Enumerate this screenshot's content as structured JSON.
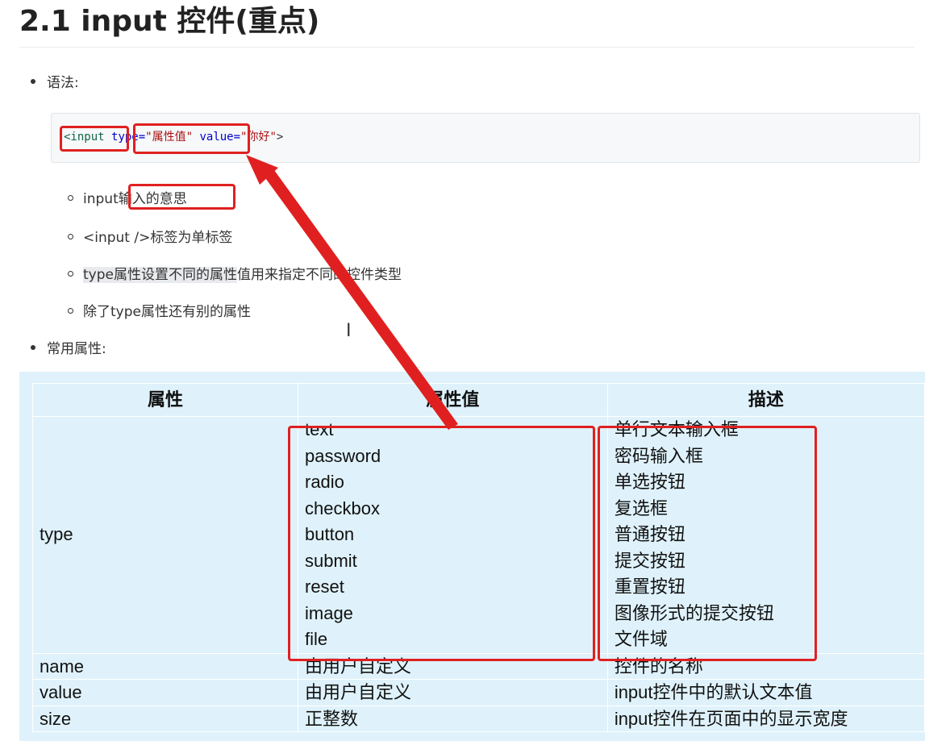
{
  "heading": "2.1 input 控件(重点)",
  "syntax_label": "语法:",
  "code": {
    "tag_open": "<input",
    "attr_type": "type=",
    "val_type": "\"属性值\"",
    "attr_value": "value=",
    "val_value": "\"你好\"",
    "tag_close": ">"
  },
  "notes": [
    {
      "prefix": "input",
      "rest": "输入的意思"
    },
    {
      "text": "<input />标签为单标签"
    },
    {
      "highlight": "type属性设置不同的属性",
      "rest": "值用来指定不同的控件类型"
    },
    {
      "text": "除了type属性还有别的属性"
    }
  ],
  "common_label": "常用属性:",
  "table": {
    "headers": [
      "属性",
      "属性值",
      "描述"
    ],
    "type_attr": "type",
    "type_values": [
      "text",
      "password",
      "radio",
      "checkbox",
      "button",
      "submit",
      "reset",
      "image",
      "file"
    ],
    "type_descs": [
      "单行文本输入框",
      "密码输入框",
      "单选按钮",
      "复选框",
      "普通按钮",
      "提交按钮",
      "重置按钮",
      "图像形式的提交按钮",
      "文件域"
    ],
    "rows": [
      {
        "attr": "name",
        "value": "由用户自定义",
        "desc": "控件的名称"
      },
      {
        "attr": "value",
        "value": "由用户自定义",
        "desc": "input控件中的默认文本值"
      },
      {
        "attr": "size",
        "value": "正整数",
        "desc": "input控件在页面中的显示宽度"
      }
    ]
  },
  "colors": {
    "annotation_red": "#e02020",
    "table_bg": "#dff2fb"
  },
  "cursor_icon": "text-cursor-icon"
}
